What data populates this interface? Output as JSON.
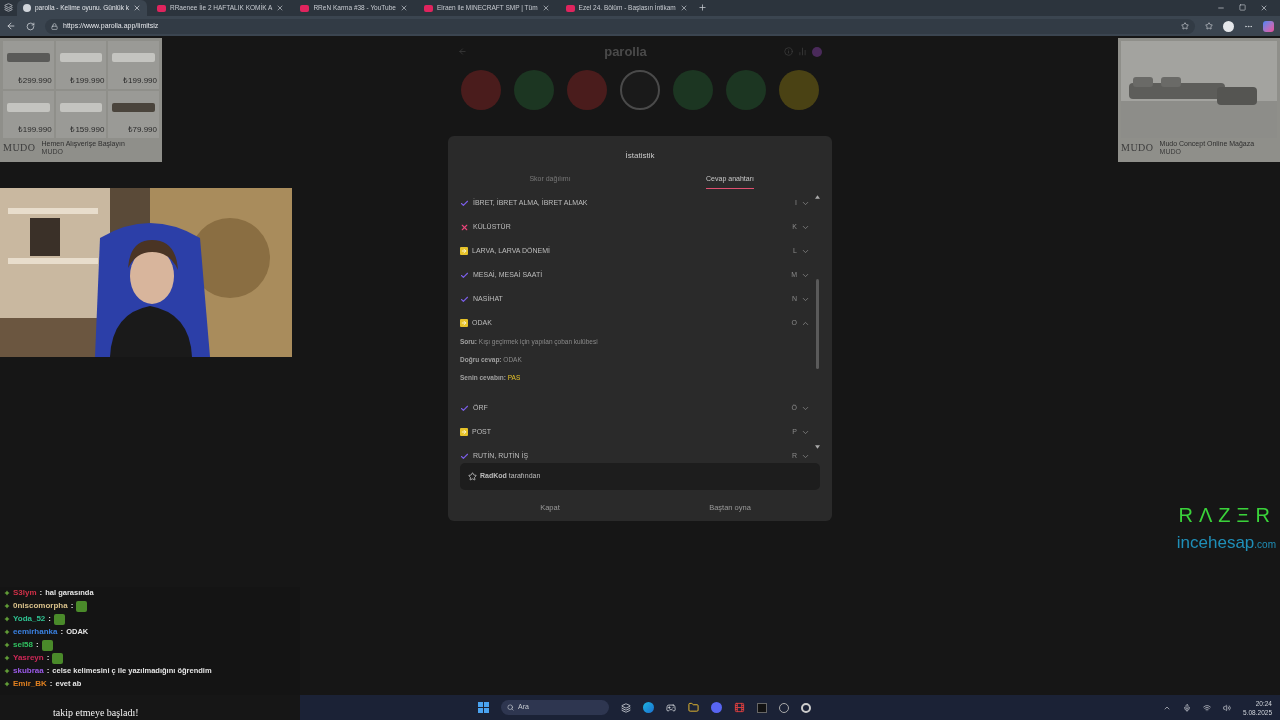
{
  "browser": {
    "tabs": [
      {
        "title": "parolla - Kelime oyunu. Günlük k",
        "selected": true,
        "kind": "site"
      },
      {
        "title": "RRaenee İle 2 HAFTALIK KOMİK A",
        "selected": false,
        "kind": "video"
      },
      {
        "title": "RReN Karma #38 - YouTube",
        "selected": false,
        "kind": "video"
      },
      {
        "title": "Elraen ile MINECRAFT SMP | Tüm",
        "selected": false,
        "kind": "video"
      },
      {
        "title": "Ezel 24. Bölüm - Başlasın İntikam",
        "selected": false,
        "kind": "video"
      }
    ],
    "url": "https://www.parolla.app/limitsiz"
  },
  "ad_left": {
    "prices": [
      "₺299.990",
      "₺199.990",
      "₺199.990",
      "₺199.990",
      "₺159.990",
      "₺79.990"
    ],
    "brand": "MUDO",
    "headline": "Hemen Alışverişe Başlayın",
    "source": "MUDO"
  },
  "ad_right": {
    "brand": "MUDO",
    "headline": "Mudo Concept Online Mağaza",
    "source": "MUDO"
  },
  "game": {
    "title": "parolla",
    "letters": [
      {
        "color": "#4a1c1c",
        "selected": false
      },
      {
        "color": "#1c3622",
        "selected": false
      },
      {
        "color": "#4a1c1c",
        "selected": false
      },
      {
        "color": "#1a1a1a",
        "selected": true
      },
      {
        "color": "#1c3622",
        "selected": false
      },
      {
        "color": "#1c3622",
        "selected": false
      },
      {
        "color": "#4a4214",
        "selected": false
      }
    ]
  },
  "dialog": {
    "title": "İstatistik",
    "tabs": [
      {
        "label": "Skor dağılımı",
        "selected": false
      },
      {
        "label": "Cevap anahtarı",
        "selected": true
      }
    ],
    "answers": [
      {
        "kind": "correct",
        "word": "İBRET, İBRET ALMA, İBRET ALMAK",
        "letter": "I",
        "expanded": false
      },
      {
        "kind": "wrong",
        "word": "KÜLÜSTÜR",
        "letter": "K",
        "expanded": false
      },
      {
        "kind": "pass",
        "word": "LARVA, LARVA DÖNEMİ",
        "letter": "L",
        "expanded": false
      },
      {
        "kind": "correct",
        "word": "MESAİ, MESAİ SAATİ",
        "letter": "M",
        "expanded": false
      },
      {
        "kind": "correct",
        "word": "NASİHAT",
        "letter": "N",
        "expanded": false
      },
      {
        "kind": "pass",
        "word": "ODAK",
        "letter": "O",
        "expanded": true,
        "details": [
          {
            "label": "Soru:",
            "value": "Kışı geçirmek için yapılan çoban kulübesi",
            "kind": "plain"
          },
          {
            "label": "Doğru cevap:",
            "value": "ODAK",
            "kind": "plain"
          },
          {
            "label": "Senin cevabın:",
            "value": "PAS",
            "kind": "pass"
          }
        ]
      },
      {
        "kind": "correct",
        "word": "ÖRF",
        "letter": "Ö",
        "expanded": false
      },
      {
        "kind": "pass",
        "word": "POST",
        "letter": "P",
        "expanded": false
      },
      {
        "kind": "correct",
        "word": "RUTİN, RUTİN İŞ",
        "letter": "R",
        "expanded": false
      }
    ],
    "credit": {
      "author": "RadKod",
      "suffix": "tarafından"
    },
    "buttons": [
      "Kapat",
      "Baştan oyna"
    ]
  },
  "chat": [
    {
      "user": "S3lym",
      "color": "#d03048",
      "separator": ":",
      "text": "hal garasında",
      "emote": false
    },
    {
      "user": "0niscomorpha",
      "color": "#d8c08a",
      "separator": ":",
      "emote": true
    },
    {
      "user": "Yoda_52",
      "color": "#2ec090",
      "separator": ":",
      "emote": true
    },
    {
      "user": "eemirhanka",
      "color": "#3a80e0",
      "separator": ":",
      "text": "ODAK",
      "emote": false
    },
    {
      "user": "sel58",
      "color": "#30c060",
      "separator": ":",
      "emote": true
    },
    {
      "user": "Yasreyn",
      "color": "#d02858",
      "separator": ":",
      "emote": true
    },
    {
      "user": "skubraa",
      "color": "#9a5ae8",
      "separator": ":",
      "text": "celse kelimesini ç ile yazılmadığını öğrendim",
      "emote": false
    },
    {
      "user": "Emir_BK",
      "color": "#e08020",
      "separator": ":",
      "text": "evet ab",
      "emote": false
    }
  ],
  "follow_alert": "takip etmeye başladı!",
  "sponsor": {
    "brand": "RΛZΞR",
    "partner": "incehesap",
    "domain": ".com"
  },
  "taskbar": {
    "search_placeholder": "Ara",
    "time": "20:24",
    "date": "5.08.2025"
  }
}
